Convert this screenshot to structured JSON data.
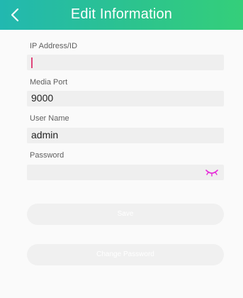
{
  "header": {
    "title": "Edit Information",
    "back_icon": "chevron-left-icon",
    "background_colors": [
      "#22b8b0",
      "#34cf7a"
    ]
  },
  "form": {
    "ip": {
      "label": "IP Address/ID",
      "value": ""
    },
    "port": {
      "label": "Media Port",
      "value": "9000"
    },
    "username": {
      "label": "User Name",
      "value": "admin"
    },
    "password": {
      "label": "Password",
      "value": "",
      "toggle_icon": "eye-closed-icon",
      "toggle_color": "#e62bd8"
    }
  },
  "buttons": {
    "save": "Save",
    "change_password": "Change Password"
  }
}
